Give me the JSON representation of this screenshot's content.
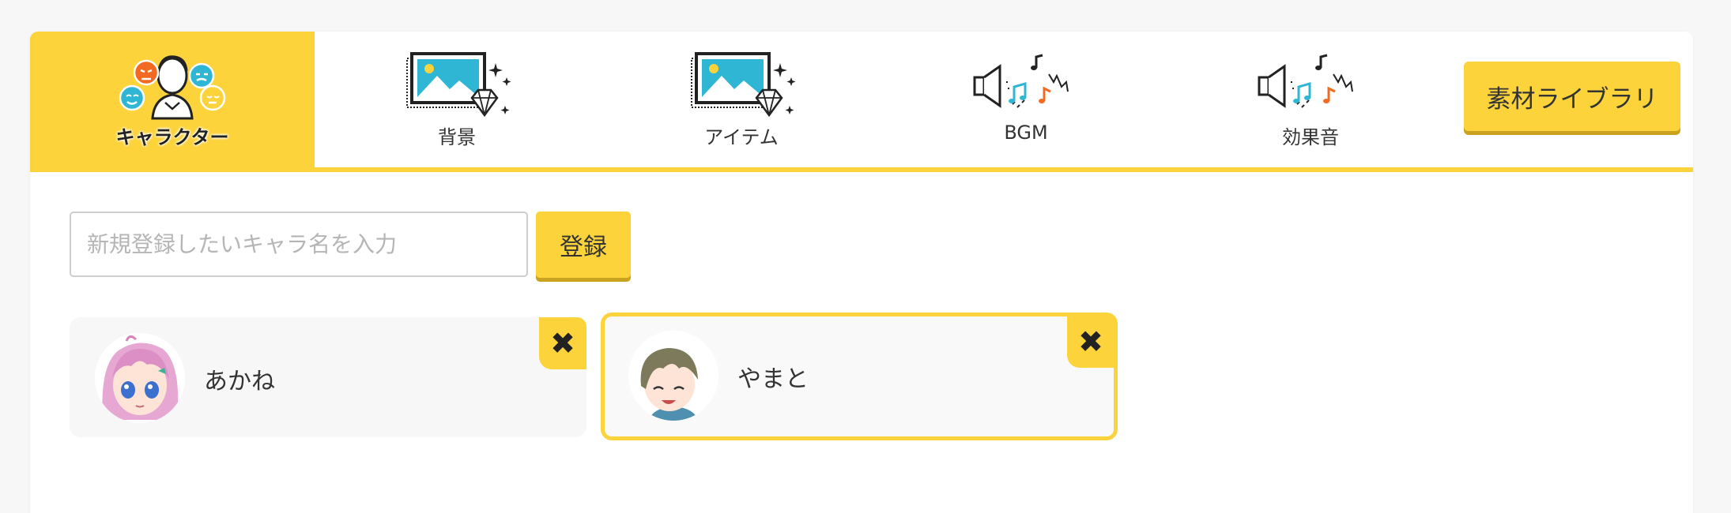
{
  "tabs": [
    {
      "label": "キャラクター",
      "icon": "character-faces-icon",
      "active": true
    },
    {
      "label": "背景",
      "icon": "background-image-icon",
      "active": false
    },
    {
      "label": "アイテム",
      "icon": "item-image-icon",
      "active": false
    },
    {
      "label": "BGM",
      "icon": "bgm-speaker-icon",
      "active": false
    },
    {
      "label": "効果音",
      "icon": "sound-effect-speaker-icon",
      "active": false
    }
  ],
  "library_button": "素材ライブラリ",
  "register": {
    "placeholder": "新規登録したいキャラ名を入力",
    "value": "",
    "button": "登録"
  },
  "characters": [
    {
      "name": "あかね",
      "selected": false,
      "delete_label": "✖"
    },
    {
      "name": "やまと",
      "selected": true,
      "delete_label": "✖"
    }
  ],
  "colors": {
    "accent": "#fdd33b",
    "accent_shadow": "#caa220",
    "icon_cyan": "#2fb6d4",
    "icon_orange": "#f26a21"
  }
}
